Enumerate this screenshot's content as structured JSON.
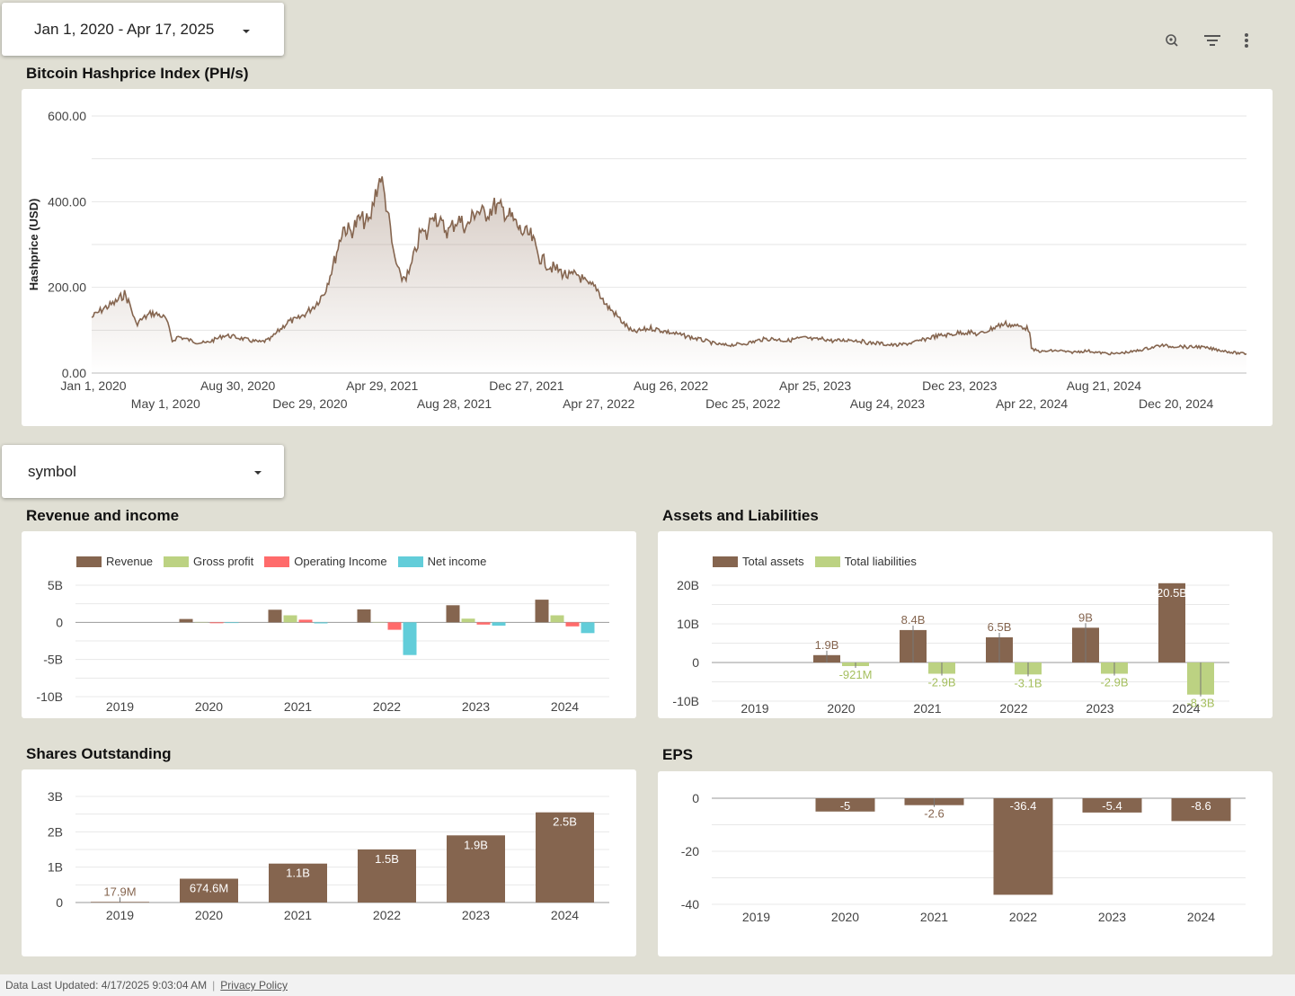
{
  "date_range": {
    "label": "Jan 1, 2020 - Apr 17, 2025"
  },
  "symbol_filter": {
    "label": "symbol"
  },
  "toolbar": {
    "icons": [
      "zoom-icon",
      "filter-icon",
      "more-vert-icon"
    ]
  },
  "colors": {
    "brown": "#85654f",
    "green": "#bcd282",
    "red": "#ff6b6b",
    "cyan": "#62cdd9",
    "background": "#e0dfd4"
  },
  "footer": {
    "updated": "Data Last Updated: 4/17/2025 9:03:04 AM",
    "privacy": "Privacy Policy"
  },
  "chart_data": [
    {
      "id": "hashprice",
      "type": "area",
      "title": "Bitcoin Hashprice Index (PH/s)",
      "ylabel": "Hashprice (USD)",
      "ylim": [
        0,
        600
      ],
      "y_ticks": [
        "0.00",
        "200.00",
        "400.00",
        "600.00"
      ],
      "x_ticks_top": [
        "Jan 1, 2020",
        "Aug 30, 2020",
        "Apr 29, 2021",
        "Dec 27, 2021",
        "Aug 26, 2022",
        "Apr 25, 2023",
        "Dec 23, 2023",
        "Aug 21, 2024"
      ],
      "x_ticks_bottom": [
        "May 1, 2020",
        "Dec 29, 2020",
        "Aug 28, 2021",
        "Apr 27, 2022",
        "Dec 25, 2022",
        "Aug 24, 2023",
        "Apr 22, 2024",
        "Dec 20, 2024"
      ],
      "x_range": [
        "2020-01-01",
        "2025-04-17"
      ],
      "points": [
        [
          "2020-01-01",
          130
        ],
        [
          "2020-01-20",
          150
        ],
        [
          "2020-02-10",
          165
        ],
        [
          "2020-02-25",
          185
        ],
        [
          "2020-03-05",
          160
        ],
        [
          "2020-03-15",
          115
        ],
        [
          "2020-03-25",
          125
        ],
        [
          "2020-04-10",
          140
        ],
        [
          "2020-04-25",
          135
        ],
        [
          "2020-05-05",
          125
        ],
        [
          "2020-05-15",
          75
        ],
        [
          "2020-05-25",
          85
        ],
        [
          "2020-06-10",
          78
        ],
        [
          "2020-06-25",
          72
        ],
        [
          "2020-07-10",
          70
        ],
        [
          "2020-07-25",
          78
        ],
        [
          "2020-08-10",
          88
        ],
        [
          "2020-08-25",
          85
        ],
        [
          "2020-09-10",
          80
        ],
        [
          "2020-09-25",
          75
        ],
        [
          "2020-10-10",
          72
        ],
        [
          "2020-10-25",
          78
        ],
        [
          "2020-11-10",
          100
        ],
        [
          "2020-11-25",
          120
        ],
        [
          "2020-12-10",
          125
        ],
        [
          "2020-12-25",
          140
        ],
        [
          "2021-01-10",
          160
        ],
        [
          "2021-01-25",
          190
        ],
        [
          "2021-02-10",
          260
        ],
        [
          "2021-02-25",
          340
        ],
        [
          "2021-03-10",
          330
        ],
        [
          "2021-03-25",
          360
        ],
        [
          "2021-04-10",
          350
        ],
        [
          "2021-04-20",
          420
        ],
        [
          "2021-04-29",
          460
        ],
        [
          "2021-05-10",
          380
        ],
        [
          "2021-05-20",
          280
        ],
        [
          "2021-06-01",
          220
        ],
        [
          "2021-06-15",
          230
        ],
        [
          "2021-06-25",
          280
        ],
        [
          "2021-07-05",
          330
        ],
        [
          "2021-07-15",
          320
        ],
        [
          "2021-07-25",
          380
        ],
        [
          "2021-08-05",
          350
        ],
        [
          "2021-08-20",
          330
        ],
        [
          "2021-09-05",
          360
        ],
        [
          "2021-09-20",
          340
        ],
        [
          "2021-10-05",
          380
        ],
        [
          "2021-10-20",
          370
        ],
        [
          "2021-11-05",
          390
        ],
        [
          "2021-11-20",
          380
        ],
        [
          "2021-12-05",
          360
        ],
        [
          "2021-12-20",
          330
        ],
        [
          "2022-01-05",
          320
        ],
        [
          "2022-01-20",
          270
        ],
        [
          "2022-02-05",
          250
        ],
        [
          "2022-02-20",
          240
        ],
        [
          "2022-03-10",
          225
        ],
        [
          "2022-03-25",
          230
        ],
        [
          "2022-04-10",
          205
        ],
        [
          "2022-04-25",
          200
        ],
        [
          "2022-05-10",
          160
        ],
        [
          "2022-05-25",
          140
        ],
        [
          "2022-06-10",
          115
        ],
        [
          "2022-06-25",
          95
        ],
        [
          "2022-07-10",
          100
        ],
        [
          "2022-07-25",
          105
        ],
        [
          "2022-08-10",
          100
        ],
        [
          "2022-08-25",
          95
        ],
        [
          "2022-09-10",
          90
        ],
        [
          "2022-09-25",
          85
        ],
        [
          "2022-10-10",
          80
        ],
        [
          "2022-10-25",
          75
        ],
        [
          "2022-11-10",
          68
        ],
        [
          "2022-11-25",
          65
        ],
        [
          "2022-12-10",
          66
        ],
        [
          "2022-12-25",
          68
        ],
        [
          "2023-01-10",
          72
        ],
        [
          "2023-01-25",
          78
        ],
        [
          "2023-02-10",
          80
        ],
        [
          "2023-02-25",
          78
        ],
        [
          "2023-03-10",
          75
        ],
        [
          "2023-03-25",
          80
        ],
        [
          "2023-04-10",
          82
        ],
        [
          "2023-04-25",
          78
        ],
        [
          "2023-05-10",
          80
        ],
        [
          "2023-05-25",
          75
        ],
        [
          "2023-06-10",
          76
        ],
        [
          "2023-06-25",
          78
        ],
        [
          "2023-07-10",
          75
        ],
        [
          "2023-07-25",
          70
        ],
        [
          "2023-08-10",
          70
        ],
        [
          "2023-08-25",
          66
        ],
        [
          "2023-09-10",
          65
        ],
        [
          "2023-09-25",
          68
        ],
        [
          "2023-10-10",
          72
        ],
        [
          "2023-10-25",
          78
        ],
        [
          "2023-11-10",
          85
        ],
        [
          "2023-11-25",
          88
        ],
        [
          "2023-12-10",
          90
        ],
        [
          "2023-12-25",
          95
        ],
        [
          "2024-01-10",
          95
        ],
        [
          "2024-01-25",
          90
        ],
        [
          "2024-02-10",
          100
        ],
        [
          "2024-02-25",
          110
        ],
        [
          "2024-03-10",
          115
        ],
        [
          "2024-03-25",
          110
        ],
        [
          "2024-04-10",
          108
        ],
        [
          "2024-04-19",
          100
        ],
        [
          "2024-04-22",
          55
        ],
        [
          "2024-05-10",
          50
        ],
        [
          "2024-05-25",
          52
        ],
        [
          "2024-06-10",
          52
        ],
        [
          "2024-06-25",
          48
        ],
        [
          "2024-07-10",
          50
        ],
        [
          "2024-07-25",
          52
        ],
        [
          "2024-08-10",
          48
        ],
        [
          "2024-08-25",
          46
        ],
        [
          "2024-09-10",
          45
        ],
        [
          "2024-09-25",
          48
        ],
        [
          "2024-10-10",
          50
        ],
        [
          "2024-10-25",
          55
        ],
        [
          "2024-11-10",
          60
        ],
        [
          "2024-11-25",
          65
        ],
        [
          "2024-12-10",
          62
        ],
        [
          "2024-12-25",
          63
        ],
        [
          "2025-01-10",
          60
        ],
        [
          "2025-01-25",
          62
        ],
        [
          "2025-02-10",
          58
        ],
        [
          "2025-02-25",
          55
        ],
        [
          "2025-03-10",
          52
        ],
        [
          "2025-03-25",
          48
        ],
        [
          "2025-04-05",
          46
        ],
        [
          "2025-04-17",
          45
        ]
      ]
    },
    {
      "id": "revenue",
      "type": "bar",
      "title": "Revenue and income",
      "categories": [
        "2019",
        "2020",
        "2021",
        "2022",
        "2023",
        "2024"
      ],
      "ylim": [
        -10,
        5
      ],
      "y_ticks": [
        {
          "v": 5,
          "label": "5B"
        },
        {
          "v": 0,
          "label": "0"
        },
        {
          "v": -5,
          "label": "-5B"
        },
        {
          "v": -10,
          "label": "-10B"
        }
      ],
      "unit": "B",
      "series": [
        {
          "name": "Revenue",
          "color": "#85654f",
          "values": [
            0,
            0.45,
            1.7,
            1.75,
            2.3,
            3.05
          ]
        },
        {
          "name": "Gross profit",
          "color": "#bcd282",
          "values": [
            0,
            0.05,
            0.95,
            0.05,
            0.5,
            0.95
          ]
        },
        {
          "name": "Operating Income",
          "color": "#ff6b6b",
          "values": [
            0,
            -0.12,
            0.35,
            -1.0,
            -0.3,
            -0.55
          ]
        },
        {
          "name": "Net income",
          "color": "#62cdd9",
          "values": [
            0,
            -0.1,
            -0.15,
            -4.4,
            -0.45,
            -1.45
          ]
        }
      ]
    },
    {
      "id": "assets",
      "type": "bar",
      "title": "Assets and Liabilities",
      "categories": [
        "2019",
        "2020",
        "2021",
        "2022",
        "2023",
        "2024"
      ],
      "ylim": [
        -10,
        20
      ],
      "y_ticks": [
        {
          "v": 20,
          "label": "20B"
        },
        {
          "v": 10,
          "label": "10B"
        },
        {
          "v": 0,
          "label": "0"
        },
        {
          "v": -10,
          "label": "-10B"
        }
      ],
      "series": [
        {
          "name": "Total assets",
          "color": "#85654f",
          "values": [
            0,
            1.9,
            8.4,
            6.5,
            9,
            20.5
          ],
          "labels": [
            "",
            "1.9B",
            "8.4B",
            "6.5B",
            "9B",
            "20.5B"
          ]
        },
        {
          "name": "Total liabilities",
          "color": "#bcd282",
          "values": [
            0,
            -0.921,
            -2.9,
            -3.1,
            -2.9,
            -8.3
          ],
          "labels": [
            "",
            "-921M",
            "-2.9B",
            "-3.1B",
            "-2.9B",
            "-8.3B"
          ]
        }
      ]
    },
    {
      "id": "shares",
      "type": "bar",
      "title": "Shares Outstanding",
      "categories": [
        "2019",
        "2020",
        "2021",
        "2022",
        "2023",
        "2024"
      ],
      "ylim": [
        0,
        3
      ],
      "y_ticks": [
        {
          "v": 3,
          "label": "3B"
        },
        {
          "v": 2,
          "label": "2B"
        },
        {
          "v": 1,
          "label": "1B"
        },
        {
          "v": 0,
          "label": "0"
        }
      ],
      "series": [
        {
          "name": "",
          "color": "#85654f",
          "values": [
            0.0179,
            0.6746,
            1.1,
            1.5,
            1.9,
            2.55
          ],
          "labels": [
            "17.9M",
            "674.6M",
            "1.1B",
            "1.5B",
            "1.9B",
            "2.5B"
          ]
        }
      ]
    },
    {
      "id": "eps",
      "type": "bar",
      "title": "EPS",
      "categories": [
        "2019",
        "2020",
        "2021",
        "2022",
        "2023",
        "2024"
      ],
      "ylim": [
        -40,
        0
      ],
      "y_ticks": [
        {
          "v": 0,
          "label": "0"
        },
        {
          "v": -20,
          "label": "-20"
        },
        {
          "v": -40,
          "label": "-40"
        }
      ],
      "series": [
        {
          "name": "",
          "color": "#85654f",
          "values": [
            0,
            -5,
            -2.6,
            -36.4,
            -5.4,
            -8.6
          ],
          "labels": [
            "",
            "-5",
            "-2.6",
            "-36.4",
            "-5.4",
            "-8.6"
          ]
        }
      ]
    }
  ]
}
